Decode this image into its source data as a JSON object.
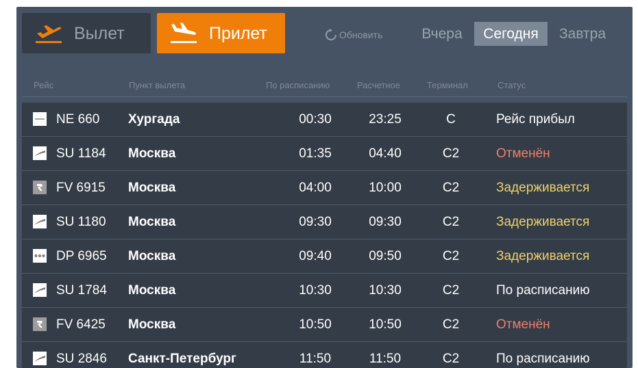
{
  "tabs": {
    "departure": {
      "label": "Вылет",
      "icon": "plane-takeoff-icon"
    },
    "arrival": {
      "label": "Прилет",
      "icon": "plane-landing-icon",
      "active": true
    }
  },
  "refresh": {
    "label": "Обновить",
    "icon": "refresh-icon"
  },
  "days": {
    "yesterday": "Вчера",
    "today": "Сегодня",
    "tomorrow": "Завтра",
    "selected": "today"
  },
  "columns": {
    "flight": "Рейс",
    "origin": "Пункт вылета",
    "scheduled": "По расписанию",
    "estimated": "Расчетное",
    "terminal": "Терминал",
    "status": "Статус"
  },
  "colors": {
    "accent": "#f07f09",
    "cancelled": "#f07f6a",
    "delayed": "#efd26b",
    "normal": "#ffffff",
    "board_bg": "#465364",
    "row_bg": "#333c47"
  },
  "flights": [
    {
      "airline_logo": "egyptair-logo",
      "flight": "NE 660",
      "origin": "Хургада",
      "scheduled": "00:30",
      "estimated": "23:25",
      "terminal": "C",
      "status": "Рейс прибыл",
      "status_type": "normal"
    },
    {
      "airline_logo": "aeroflot-logo",
      "flight": "SU 1184",
      "origin": "Москва",
      "scheduled": "01:35",
      "estimated": "04:40",
      "terminal": "C2",
      "status": "Отменён",
      "status_type": "cancelled"
    },
    {
      "airline_logo": "rossiya-logo",
      "flight": "FV 6915",
      "origin": "Москва",
      "scheduled": "04:00",
      "estimated": "10:00",
      "terminal": "C2",
      "status": "Задерживается",
      "status_type": "delayed"
    },
    {
      "airline_logo": "aeroflot-logo",
      "flight": "SU 1180",
      "origin": "Москва",
      "scheduled": "09:30",
      "estimated": "09:30",
      "terminal": "C2",
      "status": "Задерживается",
      "status_type": "delayed"
    },
    {
      "airline_logo": "pobeda-logo",
      "flight": "DP 6965",
      "origin": "Москва",
      "scheduled": "09:40",
      "estimated": "09:50",
      "terminal": "C2",
      "status": "Задерживается",
      "status_type": "delayed"
    },
    {
      "airline_logo": "aeroflot-logo",
      "flight": "SU 1784",
      "origin": "Москва",
      "scheduled": "10:30",
      "estimated": "10:30",
      "terminal": "C2",
      "status": "По расписанию",
      "status_type": "normal"
    },
    {
      "airline_logo": "rossiya-logo",
      "flight": "FV 6425",
      "origin": "Москва",
      "scheduled": "10:50",
      "estimated": "10:50",
      "terminal": "C2",
      "status": "Отменён",
      "status_type": "cancelled"
    },
    {
      "airline_logo": "aeroflot-logo",
      "flight": "SU 2846",
      "origin": "Санкт-Петербург",
      "scheduled": "11:50",
      "estimated": "11:50",
      "terminal": "C2",
      "status": "По расписанию",
      "status_type": "normal"
    }
  ]
}
